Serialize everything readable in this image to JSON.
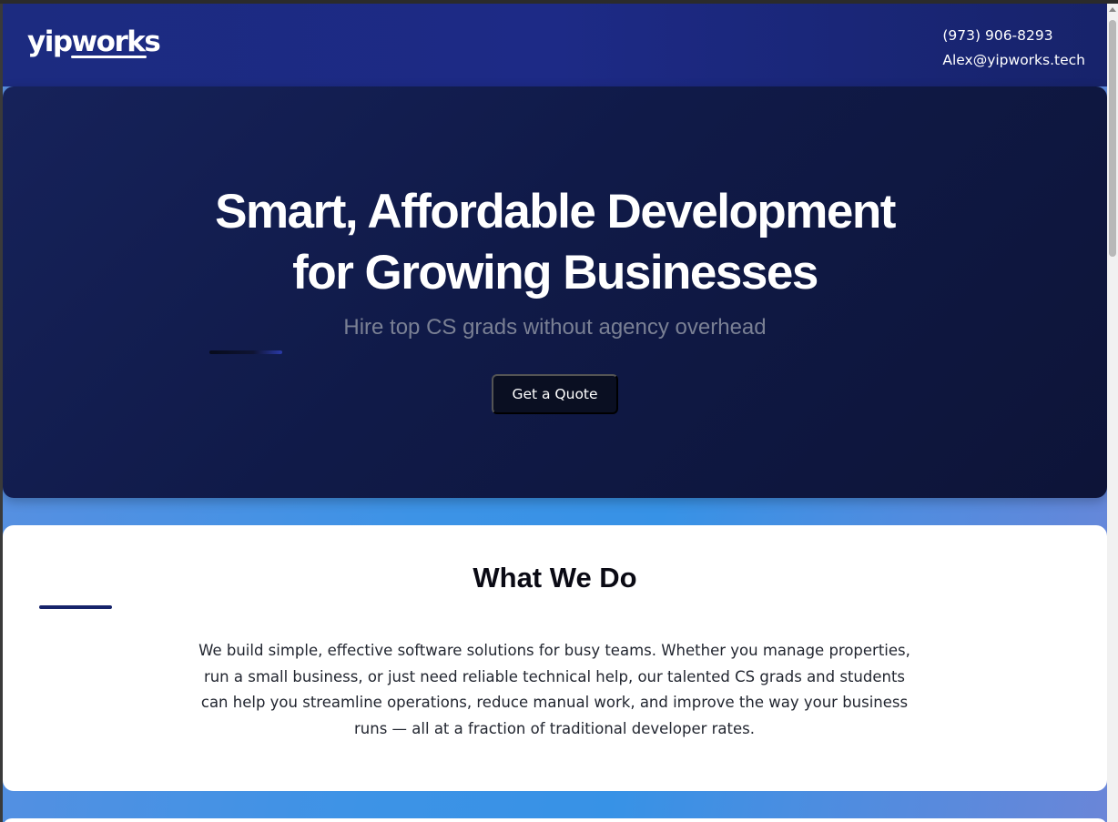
{
  "header": {
    "logo": "yipworks",
    "phone": "(973) 906-8293",
    "email": "Alex@yipworks.tech"
  },
  "hero": {
    "title_line1": "Smart, Affordable Development",
    "title_line2": "for Growing Businesses",
    "subtitle": "Hire top CS grads without agency overhead",
    "cta_label": "Get a Quote"
  },
  "what_we_do": {
    "title": "What We Do",
    "body": "We build simple, effective software solutions for busy teams. Whether you manage properties, run a small business, or just need reliable technical help, our talented CS grads and students can help you streamline operations, reduce manual work, and improve the way your business runs — all at a fraction of traditional developer rates."
  },
  "colors": {
    "header_bg": "#1c2b80",
    "hero_bg": "#101a48",
    "accent_bar": "#16236a",
    "button_bg": "#0a0f22"
  }
}
